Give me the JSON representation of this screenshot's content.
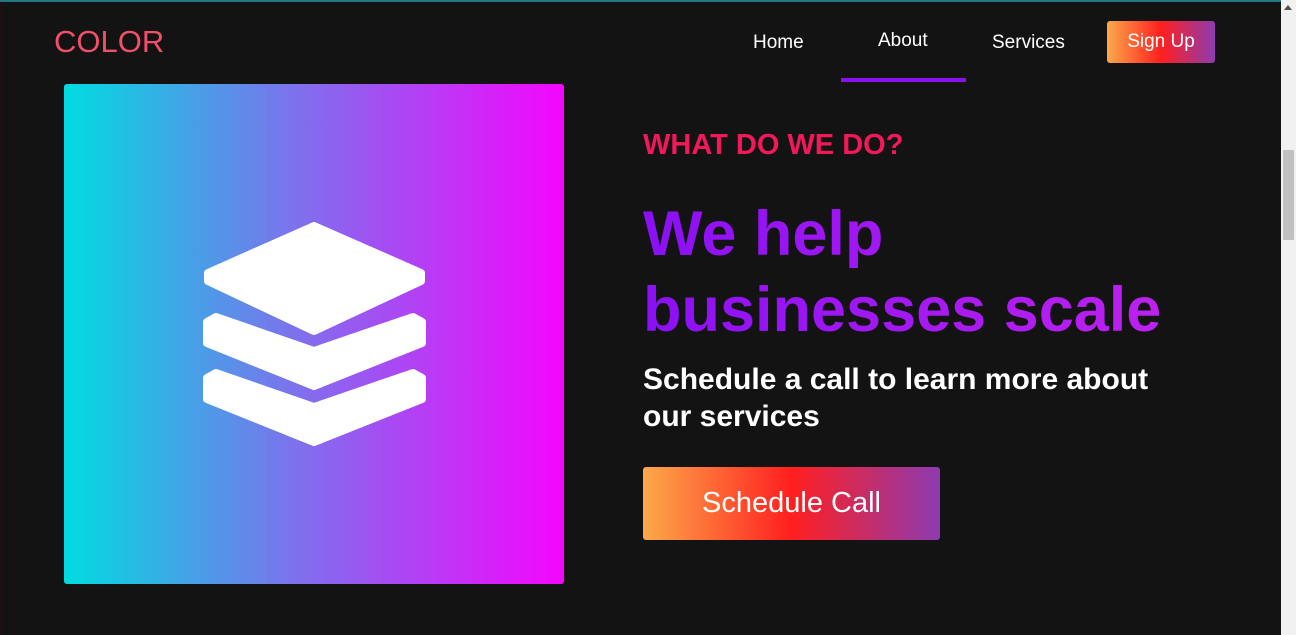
{
  "header": {
    "logo": "COLOR",
    "nav": [
      {
        "label": "Home"
      },
      {
        "label": "About",
        "active": true
      },
      {
        "label": "Services"
      }
    ],
    "signup_label": "Sign Up"
  },
  "hero": {
    "icon": "layers-icon",
    "kicker": "WHAT DO WE DO?",
    "headline": "We help businesses scale",
    "subtitle": "Schedule a call to learn more about our services",
    "cta_label": "Schedule Call"
  },
  "colors": {
    "background": "#131313",
    "accent_purple": "#8b10f5",
    "kicker": "#f2185a",
    "logo": "#f0506a"
  }
}
